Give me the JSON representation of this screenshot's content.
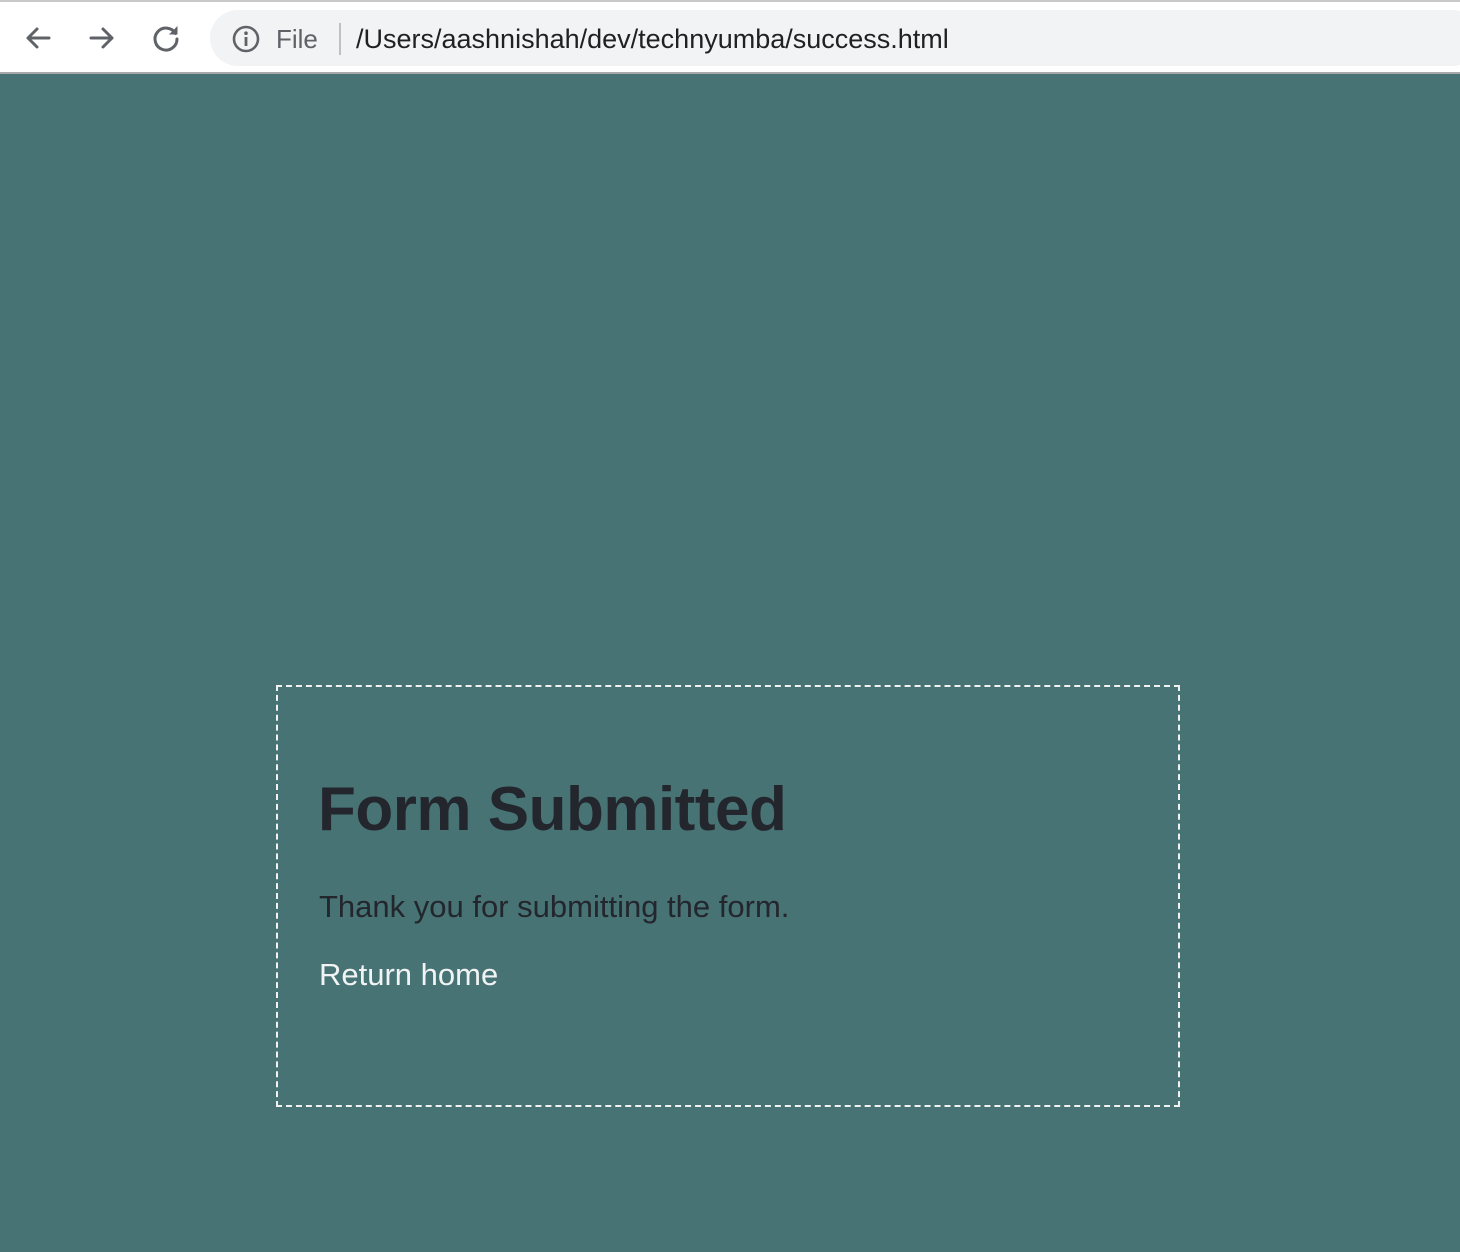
{
  "browser": {
    "scheme_label": "File",
    "url": "/Users/aashnishah/dev/technyumba/success.html",
    "icons": {
      "back": "arrow-left-icon",
      "forward": "arrow-right-icon",
      "reload": "reload-icon",
      "site_info": "info-icon"
    }
  },
  "page": {
    "background_color": "#477374",
    "card": {
      "title": "Form Submitted",
      "message": "Thank you for submitting the form.",
      "link_label": "Return home",
      "border_color": "#f2f2f2",
      "text_color": "#23262d",
      "link_color": "#f1f3f4"
    }
  }
}
